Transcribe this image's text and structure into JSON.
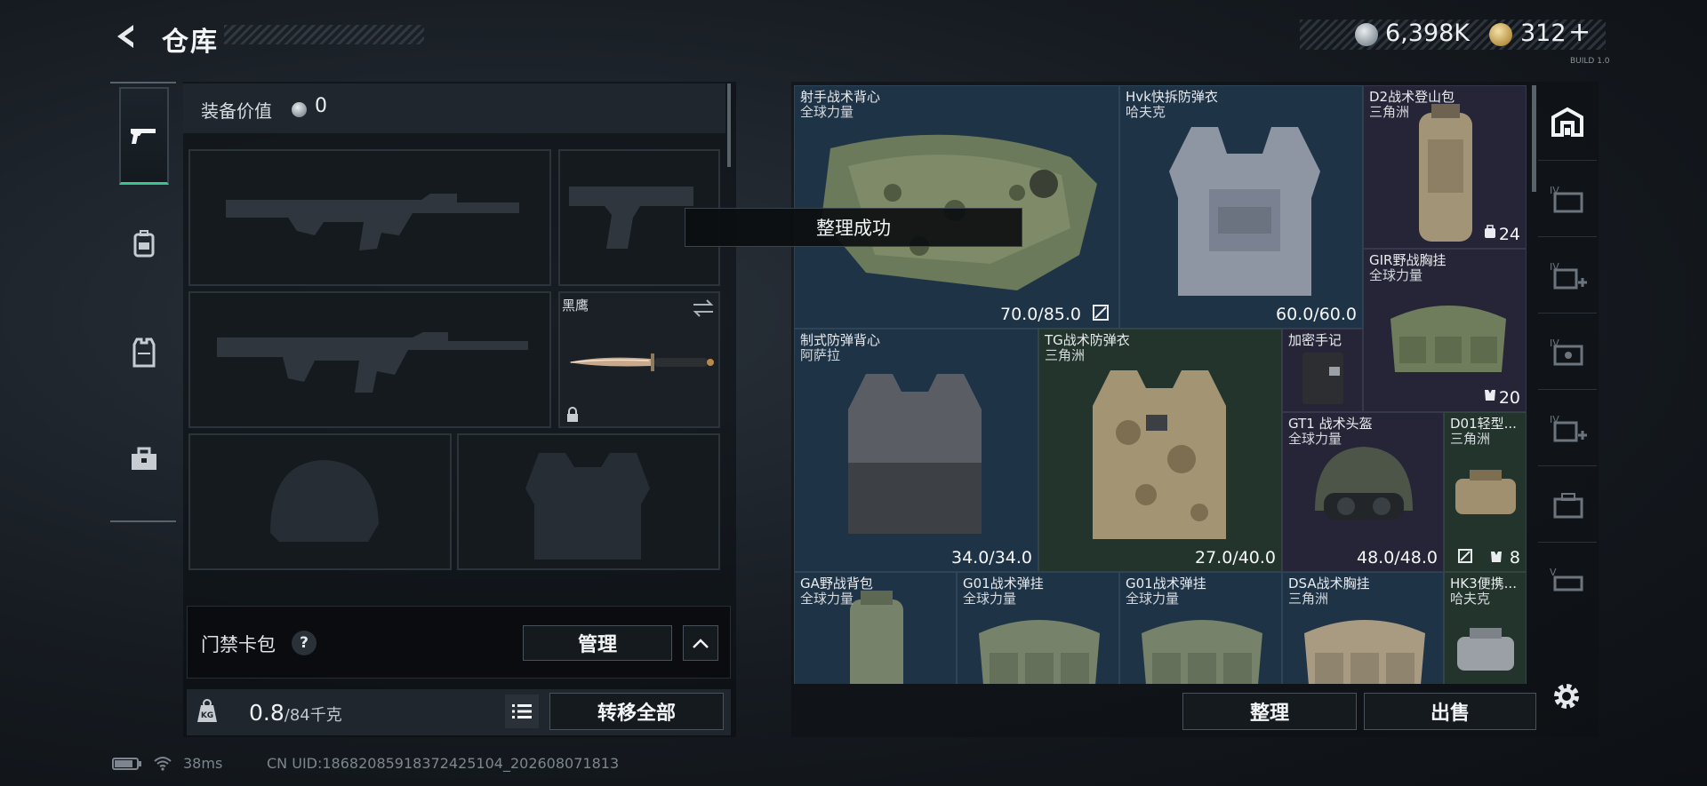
{
  "header": {
    "title": "仓库",
    "currency_silver": "6,398K",
    "currency_gold": "312",
    "plus_label": "+",
    "version": "BUILD 1.0"
  },
  "sidebar": {
    "tabs": [
      {
        "icon": "pistol-icon",
        "active": true
      },
      {
        "icon": "backpack-icon",
        "active": false
      },
      {
        "icon": "vest-icon",
        "active": false
      },
      {
        "icon": "toolbox-icon",
        "active": false
      }
    ]
  },
  "equipment": {
    "value_label": "装备价值",
    "value": "0",
    "melee_name": "黑鹰",
    "card_bag_label": "门禁卡包",
    "help_label": "?",
    "manage_label": "管理",
    "weight_current": "0.8",
    "weight_max": "/84千克",
    "transfer_all_label": "转移全部"
  },
  "inventory": {
    "toast": "整理成功",
    "items": [
      {
        "name": "射手战术背心",
        "brand": "全球力量",
        "durability": "70.0/85.0",
        "color": "blue"
      },
      {
        "name": "Hvk快拆防弹衣",
        "brand": "哈夫克",
        "durability": "60.0/60.0",
        "color": "blue"
      },
      {
        "name": "D2战术登山包",
        "brand": "三角洲",
        "count": "24",
        "color": "purple"
      },
      {
        "name": "GIR野战胸挂",
        "brand": "全球力量",
        "count": "20",
        "color": "purple"
      },
      {
        "name": "制式防弹背心",
        "brand": "阿萨拉",
        "durability": "34.0/34.0",
        "color": "blue"
      },
      {
        "name": "TG战术防弹衣",
        "brand": "三角洲",
        "durability": "27.0/40.0",
        "color": "green"
      },
      {
        "name": "加密手记",
        "brand": "",
        "color": "purple"
      },
      {
        "name": "GT1 战术头盔",
        "brand": "全球力量",
        "durability": "48.0/48.0",
        "color": "purple"
      },
      {
        "name": "D01轻型...",
        "brand": "三角洲",
        "count": "8",
        "color": "green"
      },
      {
        "name": "GA野战背包",
        "brand": "全球力量",
        "color": "blue"
      },
      {
        "name": "G01战术弹挂",
        "brand": "全球力量",
        "color": "blue"
      },
      {
        "name": "G01战术弹挂",
        "brand": "全球力量",
        "color": "blue"
      },
      {
        "name": "DSA战术胸挂",
        "brand": "三角洲",
        "color": "blue"
      },
      {
        "name": "HK3便携...",
        "brand": "哈夫克",
        "color": "green"
      }
    ],
    "sort_label": "整理",
    "sell_label": "出售"
  },
  "right_tabs": [
    "storage-home-icon",
    "storage-IV-icon",
    "storage-IV-add-icon",
    "storage-IV-case-icon",
    "storage-IV-add2-icon",
    "storage-case-icon",
    "storage-V-icon"
  ],
  "status": {
    "ping": "38ms",
    "uid": "CN UID:18682085918372425104_202608071813"
  },
  "colors": {
    "accent_green": "#39c78f",
    "rarity_blue": "#1f3347",
    "rarity_green": "#23342c",
    "rarity_purple": "#262537"
  }
}
